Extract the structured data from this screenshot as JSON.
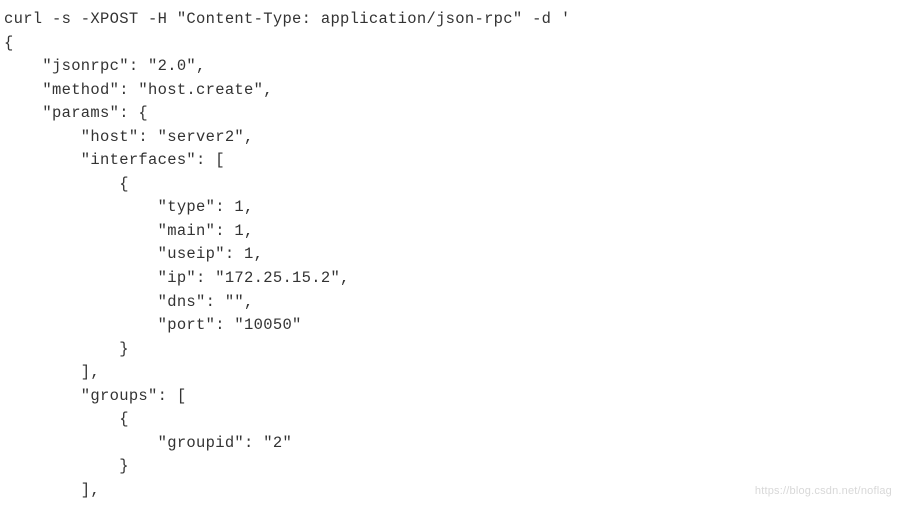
{
  "code": {
    "lines": [
      "curl -s -XPOST -H \"Content-Type: application/json-rpc\" -d '",
      "{",
      "    \"jsonrpc\": \"2.0\",",
      "    \"method\": \"host.create\",",
      "    \"params\": {",
      "        \"host\": \"server2\",",
      "        \"interfaces\": [",
      "            {",
      "                \"type\": 1,",
      "                \"main\": 1,",
      "                \"useip\": 1,",
      "                \"ip\": \"172.25.15.2\",",
      "                \"dns\": \"\",",
      "                \"port\": \"10050\"",
      "            }",
      "        ],",
      "        \"groups\": [",
      "            {",
      "                \"groupid\": \"2\"",
      "            }",
      "        ],"
    ]
  },
  "watermark": "https://blog.csdn.net/noflag"
}
